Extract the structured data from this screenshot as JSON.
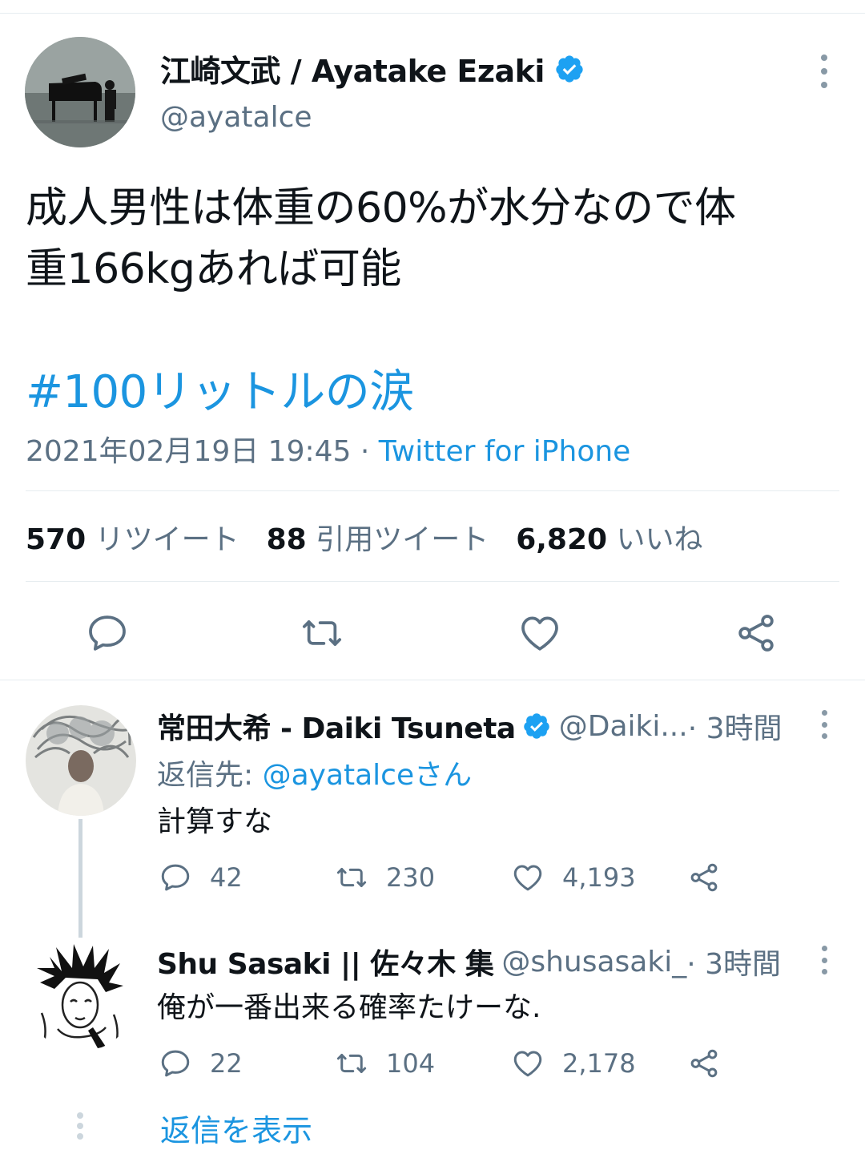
{
  "main_tweet": {
    "author_name": "江崎文武 / Ayatake Ezaki",
    "handle": "@ayatalce",
    "text_line1": "成人男性は体重の60%が水分なので体",
    "text_line2": "重166kgあれば可能",
    "hashtag": "#100リットルの涙",
    "timestamp": "2021年02月19日 19:45 · ",
    "source": "Twitter for iPhone",
    "stats": {
      "retweets_count": "570",
      "retweets_label": "リツイート",
      "quotes_count": "88",
      "quotes_label": "引用ツイート",
      "likes_count": "6,820",
      "likes_label": "いいね"
    }
  },
  "replies": [
    {
      "name": "常田大希 - Daiki Tsuneta",
      "handle": "@Daiki...",
      "time": " · 3時間",
      "reply_to_prefix": "返信先: ",
      "reply_to_handle": "@ayatalceさん",
      "text": "計算すな",
      "reply_count": "42",
      "retweet_count": "230",
      "like_count": "4,193"
    },
    {
      "name": "Shu Sasaki || 佐々木 集",
      "handle": "@shusasaki_",
      "time": " · 3時間",
      "text": "俺が一番出来る確率たけーな.",
      "reply_count": "22",
      "retweet_count": "104",
      "like_count": "2,178"
    }
  ],
  "show_replies_label": "返信を表示",
  "colors": {
    "accent": "#1b95e0",
    "secondary_text": "#5b7083",
    "divider": "#e6ecf0",
    "icon": "#5b7083"
  }
}
